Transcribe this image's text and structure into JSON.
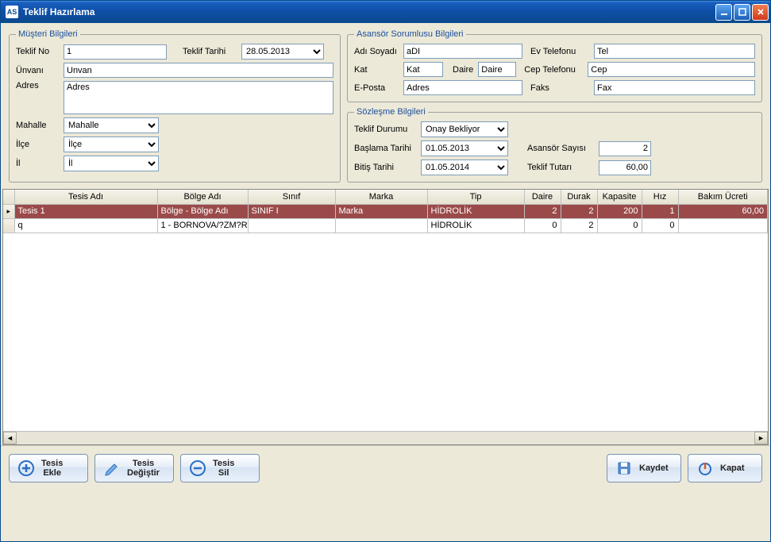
{
  "window": {
    "title": "Teklif Hazırlama",
    "app_badge": "AS"
  },
  "musteri": {
    "legend": "Müşteri Bilgileri",
    "teklif_no_label": "Teklif No",
    "teklif_no": "1",
    "teklif_tarihi_label": "Teklif Tarihi",
    "teklif_tarihi": "28.05.2013",
    "unvan_label": "Ünvanı",
    "unvan": "Unvan",
    "adres_label": "Adres",
    "adres": "Adres",
    "mahalle_label": "Mahalle",
    "mahalle": "Mahalle",
    "ilce_label": "İlçe",
    "ilce": "İlçe",
    "il_label": "İl",
    "il": "İl"
  },
  "sorumlu": {
    "legend": "Asansör Sorumlusu Bilgileri",
    "adi_label": "Adı Soyadı",
    "adi": "aDI",
    "kat_label": "Kat",
    "kat": "Kat",
    "daire_label": "Daire",
    "daire": "Daire",
    "eposta_label": "E-Posta",
    "eposta": "Adres",
    "evtel_label": "Ev Telefonu",
    "evtel": "Tel",
    "cep_label": "Cep Telefonu",
    "cep": "Cep",
    "faks_label": "Faks",
    "faks": "Fax"
  },
  "sozlesme": {
    "legend": "Sözleşme Bilgileri",
    "durum_label": "Teklif Durumu",
    "durum": "Onay Bekliyor",
    "baslama_label": "Başlama Tarihi",
    "baslama": "01.05.2013",
    "bitis_label": "Bitiş Tarihi",
    "bitis": "01.05.2014",
    "asansor_label": "Asansör Sayısı",
    "asansor": "2",
    "tutar_label": "Teklif Tutarı",
    "tutar": "60,00"
  },
  "grid": {
    "headers": [
      "Tesis Adı",
      "Bölge Adı",
      "Sınıf",
      "Marka",
      "Tip",
      "Daire",
      "Durak",
      "Kapasite",
      "Hız",
      "Bakım Ücreti"
    ],
    "rows": [
      {
        "selected": true,
        "tesis": "Tesis 1",
        "bolge": "Bölge - Bölge Adı",
        "sinif": "SINIF I",
        "marka": "Marka",
        "tip": "HİDROLİK",
        "daire": "2",
        "durak": "2",
        "kapasite": "200",
        "hiz": "1",
        "ucret": "60,00"
      },
      {
        "selected": false,
        "tesis": "q",
        "bolge": "1 - BORNOVA/?ZM?R",
        "sinif": "",
        "marka": "",
        "tip": "HİDROLİK",
        "daire": "0",
        "durak": "2",
        "kapasite": "0",
        "hiz": "0",
        "ucret": ""
      }
    ]
  },
  "buttons": {
    "ekle1": "Tesis",
    "ekle2": "Ekle",
    "degistir1": "Tesis",
    "degistir2": "Değiştir",
    "sil1": "Tesis",
    "sil2": "Sil",
    "kaydet": "Kaydet",
    "kapat": "Kapat"
  }
}
